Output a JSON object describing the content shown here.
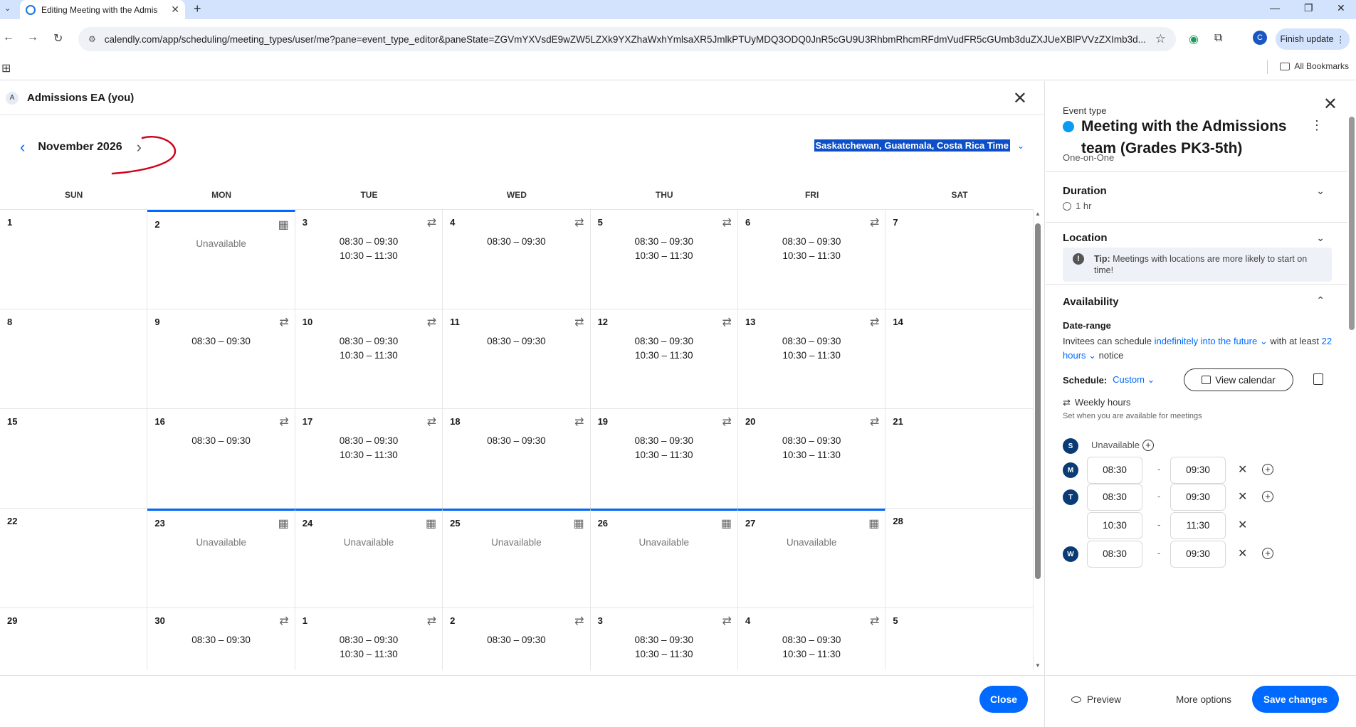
{
  "browser": {
    "tab_title": "Editing Meeting with the Admis",
    "url": "calendly.com/app/scheduling/meeting_types/user/me?pane=event_type_editor&paneState=ZGVmYXVsdE9wZW5LZXk9YXZhaWxhYmlsaXR5JmlkPTUyMDQ3ODQ0JnR5cGU9U3RhbmRhcmRFdmVudFR5cGUmb3duZXJUeXBlPVVzZXImb3d...",
    "finish_update": "Finish update",
    "profile_initial": "C",
    "all_bookmarks": "All Bookmarks"
  },
  "host": {
    "avatar_initial": "A",
    "name": "Admissions EA (you)"
  },
  "calendar": {
    "month": "November 2026",
    "timezone": "Saskatchewan, Guatemala, Costa Rica Time",
    "weekdays": [
      "SUN",
      "MON",
      "TUE",
      "WED",
      "THU",
      "FRI",
      "SAT"
    ],
    "unavailable_label": "Unavailable",
    "weeks": [
      [
        {
          "num": "1",
          "slots": []
        },
        {
          "num": "2",
          "slots": [],
          "unavailable": true,
          "icon": "calendar",
          "today": true
        },
        {
          "num": "3",
          "slots": [
            "08:30 – 09:30",
            "10:30 – 11:30"
          ],
          "icon": "repeat"
        },
        {
          "num": "4",
          "slots": [
            "08:30 – 09:30"
          ],
          "icon": "repeat"
        },
        {
          "num": "5",
          "slots": [
            "08:30 – 09:30",
            "10:30 – 11:30"
          ],
          "icon": "repeat"
        },
        {
          "num": "6",
          "slots": [
            "08:30 – 09:30",
            "10:30 – 11:30"
          ],
          "icon": "repeat"
        },
        {
          "num": "7",
          "slots": []
        }
      ],
      [
        {
          "num": "8",
          "slots": []
        },
        {
          "num": "9",
          "slots": [
            "08:30 – 09:30"
          ],
          "icon": "repeat"
        },
        {
          "num": "10",
          "slots": [
            "08:30 – 09:30",
            "10:30 – 11:30"
          ],
          "icon": "repeat"
        },
        {
          "num": "11",
          "slots": [
            "08:30 – 09:30"
          ],
          "icon": "repeat"
        },
        {
          "num": "12",
          "slots": [
            "08:30 – 09:30",
            "10:30 – 11:30"
          ],
          "icon": "repeat"
        },
        {
          "num": "13",
          "slots": [
            "08:30 – 09:30",
            "10:30 – 11:30"
          ],
          "icon": "repeat"
        },
        {
          "num": "14",
          "slots": []
        }
      ],
      [
        {
          "num": "15",
          "slots": []
        },
        {
          "num": "16",
          "slots": [
            "08:30 – 09:30"
          ],
          "icon": "repeat"
        },
        {
          "num": "17",
          "slots": [
            "08:30 – 09:30",
            "10:30 – 11:30"
          ],
          "icon": "repeat"
        },
        {
          "num": "18",
          "slots": [
            "08:30 – 09:30"
          ],
          "icon": "repeat"
        },
        {
          "num": "19",
          "slots": [
            "08:30 – 09:30",
            "10:30 – 11:30"
          ],
          "icon": "repeat"
        },
        {
          "num": "20",
          "slots": [
            "08:30 – 09:30",
            "10:30 – 11:30"
          ],
          "icon": "repeat"
        },
        {
          "num": "21",
          "slots": []
        }
      ],
      [
        {
          "num": "22",
          "slots": []
        },
        {
          "num": "23",
          "slots": [],
          "unavailable": true,
          "icon": "calendar",
          "today": true
        },
        {
          "num": "24",
          "slots": [],
          "unavailable": true,
          "icon": "calendar",
          "today": true
        },
        {
          "num": "25",
          "slots": [],
          "unavailable": true,
          "icon": "calendar",
          "today": true
        },
        {
          "num": "26",
          "slots": [],
          "unavailable": true,
          "icon": "calendar",
          "today": true
        },
        {
          "num": "27",
          "slots": [],
          "unavailable": true,
          "icon": "calendar",
          "today": true
        },
        {
          "num": "28",
          "slots": []
        }
      ],
      [
        {
          "num": "29",
          "slots": []
        },
        {
          "num": "30",
          "slots": [
            "08:30 – 09:30"
          ],
          "icon": "repeat"
        },
        {
          "num": "1",
          "slots": [
            "08:30 – 09:30",
            "10:30 – 11:30"
          ],
          "icon": "repeat"
        },
        {
          "num": "2",
          "slots": [
            "08:30 – 09:30"
          ],
          "icon": "repeat"
        },
        {
          "num": "3",
          "slots": [
            "08:30 – 09:30",
            "10:30 – 11:30"
          ],
          "icon": "repeat"
        },
        {
          "num": "4",
          "slots": [
            "08:30 – 09:30",
            "10:30 – 11:30"
          ],
          "icon": "repeat"
        },
        {
          "num": "5",
          "slots": []
        }
      ]
    ],
    "close_label": "Close"
  },
  "panel": {
    "event_type_label": "Event type",
    "event_title": "Meeting with the Admissions team (Grades PK3-5th)",
    "event_kind": "One-on-One",
    "duration_title": "Duration",
    "duration_value": "1 hr",
    "location_title": "Location",
    "tip_label": "Tip:",
    "tip_text": "Meetings with locations are more likely to start on time!",
    "availability_title": "Availability",
    "date_range_label": "Date-range",
    "date_range_pre": "Invitees can schedule",
    "date_range_link": "indefinitely into the future",
    "date_range_mid": "with at least",
    "notice_link": "22 hours",
    "date_range_post": "notice",
    "schedule_label": "Schedule:",
    "schedule_value": "Custom",
    "view_calendar": "View calendar",
    "weekly_hours_title": "Weekly hours",
    "weekly_hours_sub": "Set when you are available for meetings",
    "days": [
      {
        "letter": "S",
        "unavailable": "Unavailable"
      },
      {
        "letter": "M",
        "from": "08:30",
        "to": "09:30"
      },
      {
        "letter": "T",
        "from": "08:30",
        "to": "09:30"
      },
      {
        "letter": "",
        "from": "10:30",
        "to": "11:30"
      },
      {
        "letter": "W",
        "from": "08:30",
        "to": "09:30"
      }
    ],
    "dash": "-",
    "preview": "Preview",
    "more_options": "More options",
    "save_changes": "Save changes"
  },
  "colors": {
    "accent": "#0069ff",
    "event_dot": "#0a9cf2",
    "day_badge": "#0b3b74",
    "annotation": "#d0021b"
  }
}
